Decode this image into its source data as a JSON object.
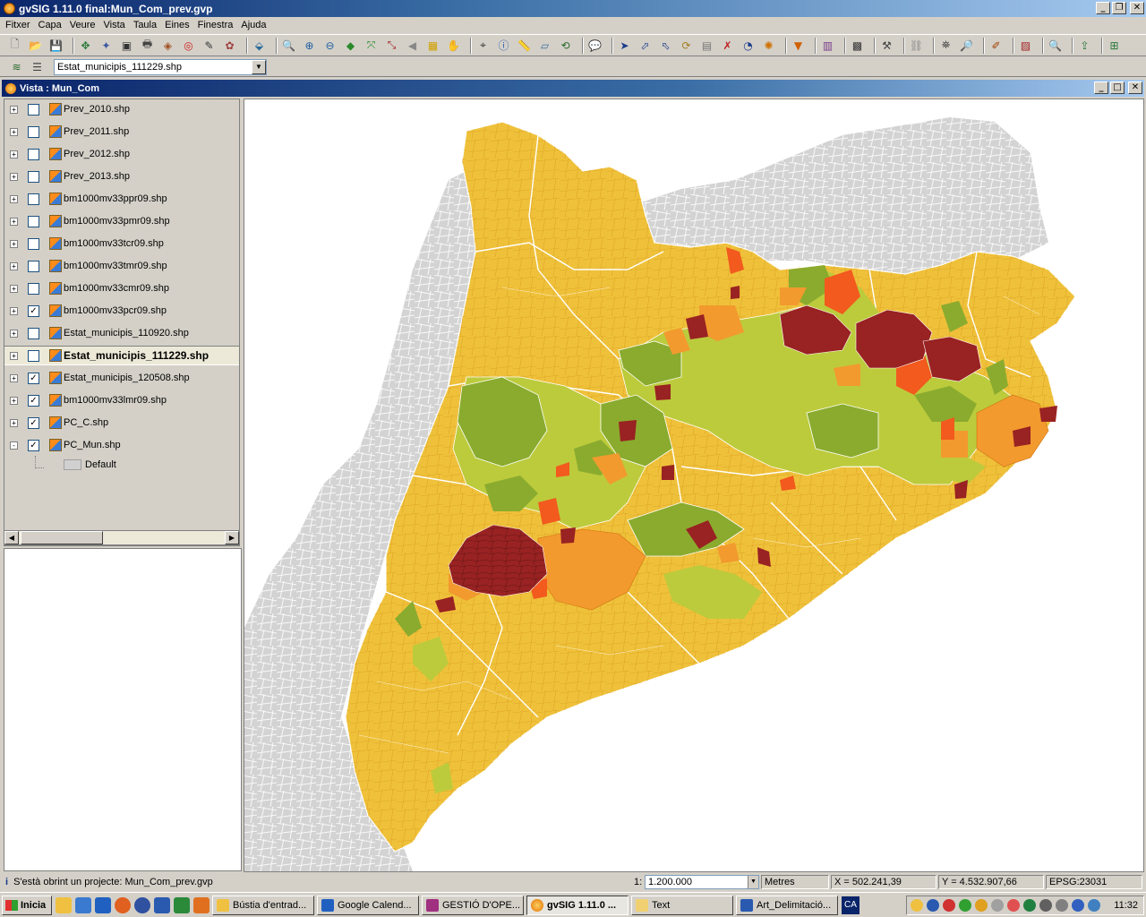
{
  "window": {
    "title": "gvSIG 1.11.0 final:Mun_Com_prev.gvp"
  },
  "menu": [
    "Fitxer",
    "Capa",
    "Veure",
    "Vista",
    "Taula",
    "Eines",
    "Finestra",
    "Ajuda"
  ],
  "toolbar": {
    "active_layer": "Estat_municipis_111229.shp"
  },
  "view": {
    "title": "Vista : Mun_Com",
    "layers": [
      {
        "name": "Prev_2010.shp",
        "checked": false
      },
      {
        "name": "Prev_2011.shp",
        "checked": false
      },
      {
        "name": "Prev_2012.shp",
        "checked": false
      },
      {
        "name": "Prev_2013.shp",
        "checked": false
      },
      {
        "name": "bm1000mv33ppr09.shp",
        "checked": false
      },
      {
        "name": "bm1000mv33pmr09.shp",
        "checked": false
      },
      {
        "name": "bm1000mv33tcr09.shp",
        "checked": false
      },
      {
        "name": "bm1000mv33tmr09.shp",
        "checked": false
      },
      {
        "name": "bm1000mv33cmr09.shp",
        "checked": false
      },
      {
        "name": "bm1000mv33pcr09.shp",
        "checked": true
      },
      {
        "name": "Estat_municipis_110920.shp",
        "checked": false
      },
      {
        "name": "Estat_municipis_111229.shp",
        "checked": false
      },
      {
        "name": "Estat_municipis_120508.shp",
        "checked": true
      },
      {
        "name": "bm1000mv33lmr09.shp",
        "checked": true
      },
      {
        "name": "PC_C.shp",
        "checked": true
      },
      {
        "name": "PC_Mun.shp",
        "checked": true
      }
    ],
    "legend_default": "Default",
    "map_colors": {
      "background": "#ffffff",
      "neighbors": "#d3d3d3",
      "yellow": "#efc13a",
      "lime": "#bccb3c",
      "green": "#8aab2e",
      "orange": "#f29a2e",
      "redorange": "#f25a1e",
      "darkred": "#992222"
    }
  },
  "status": {
    "message": "S'està obrint un projecte: Mun_Com_prev.gvp",
    "scale_prefix": "1:",
    "scale": "1.200.000",
    "units": "Metres",
    "x": "X = 502.241,39",
    "y": "Y = 4.532.907,66",
    "epsg": "EPSG:23031"
  },
  "taskbar": {
    "start": "Inicia",
    "tasks": [
      "Bústia d'entrad...",
      "Google Calend...",
      "GESTIÓ D'OPE...",
      "gvSIG 1.11.0 ...",
      "Text",
      "Art_Delimitació..."
    ],
    "lang": "CA",
    "clock": "11:32"
  }
}
